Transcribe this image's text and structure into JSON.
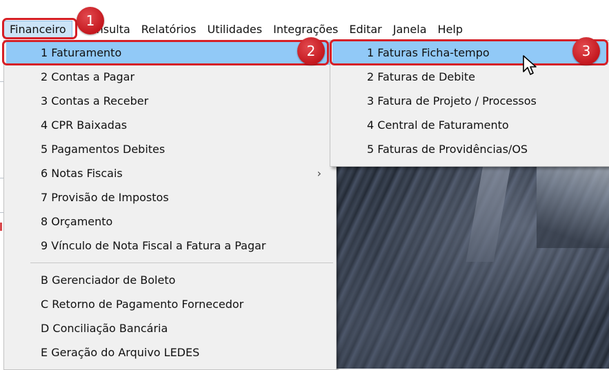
{
  "menubar": {
    "items": [
      "Financeiro",
      "Consulta",
      "Relatórios",
      "Utilidades",
      "Integrações",
      "Editar",
      "Janela",
      "Help"
    ]
  },
  "main_menu": {
    "items": [
      {
        "label": "1 Faturamento",
        "has_submenu": true,
        "highlighted": true
      },
      {
        "label": "2 Contas a Pagar"
      },
      {
        "label": "3 Contas a Receber"
      },
      {
        "label": "4 CPR Baixadas"
      },
      {
        "label": "5 Pagamentos Debites"
      },
      {
        "label": "6 Notas Fiscais",
        "has_submenu": true
      },
      {
        "label": "7 Provisão de Impostos"
      },
      {
        "label": "8 Orçamento"
      },
      {
        "label": "9 Vínculo de Nota Fiscal a Fatura a Pagar"
      },
      {
        "label": "B Gerenciador de Boleto"
      },
      {
        "label": "C Retorno de Pagamento Fornecedor"
      },
      {
        "label": "D Conciliação Bancária"
      },
      {
        "label": "E Geração do Arquivo LEDES"
      }
    ],
    "submenu_arrow": "›"
  },
  "sub_menu": {
    "items": [
      {
        "label": "1 Faturas Ficha-tempo",
        "highlighted": true
      },
      {
        "label": "2 Faturas de Debite"
      },
      {
        "label": "3 Fatura de Projeto / Processos"
      },
      {
        "label": "4 Central de Faturamento"
      },
      {
        "label": "5 Faturas de Providências/OS"
      }
    ]
  },
  "annotations": {
    "step1": "1",
    "step2": "2",
    "step3": "3",
    "color": "#d61f26"
  },
  "colors": {
    "menu_bg": "#f0f0f0",
    "highlight": "#91c9f7",
    "menubar_active": "#cce4f7"
  },
  "icons": {
    "cursor": "mouse-pointer-icon",
    "submenu": "chevron-right-icon"
  }
}
